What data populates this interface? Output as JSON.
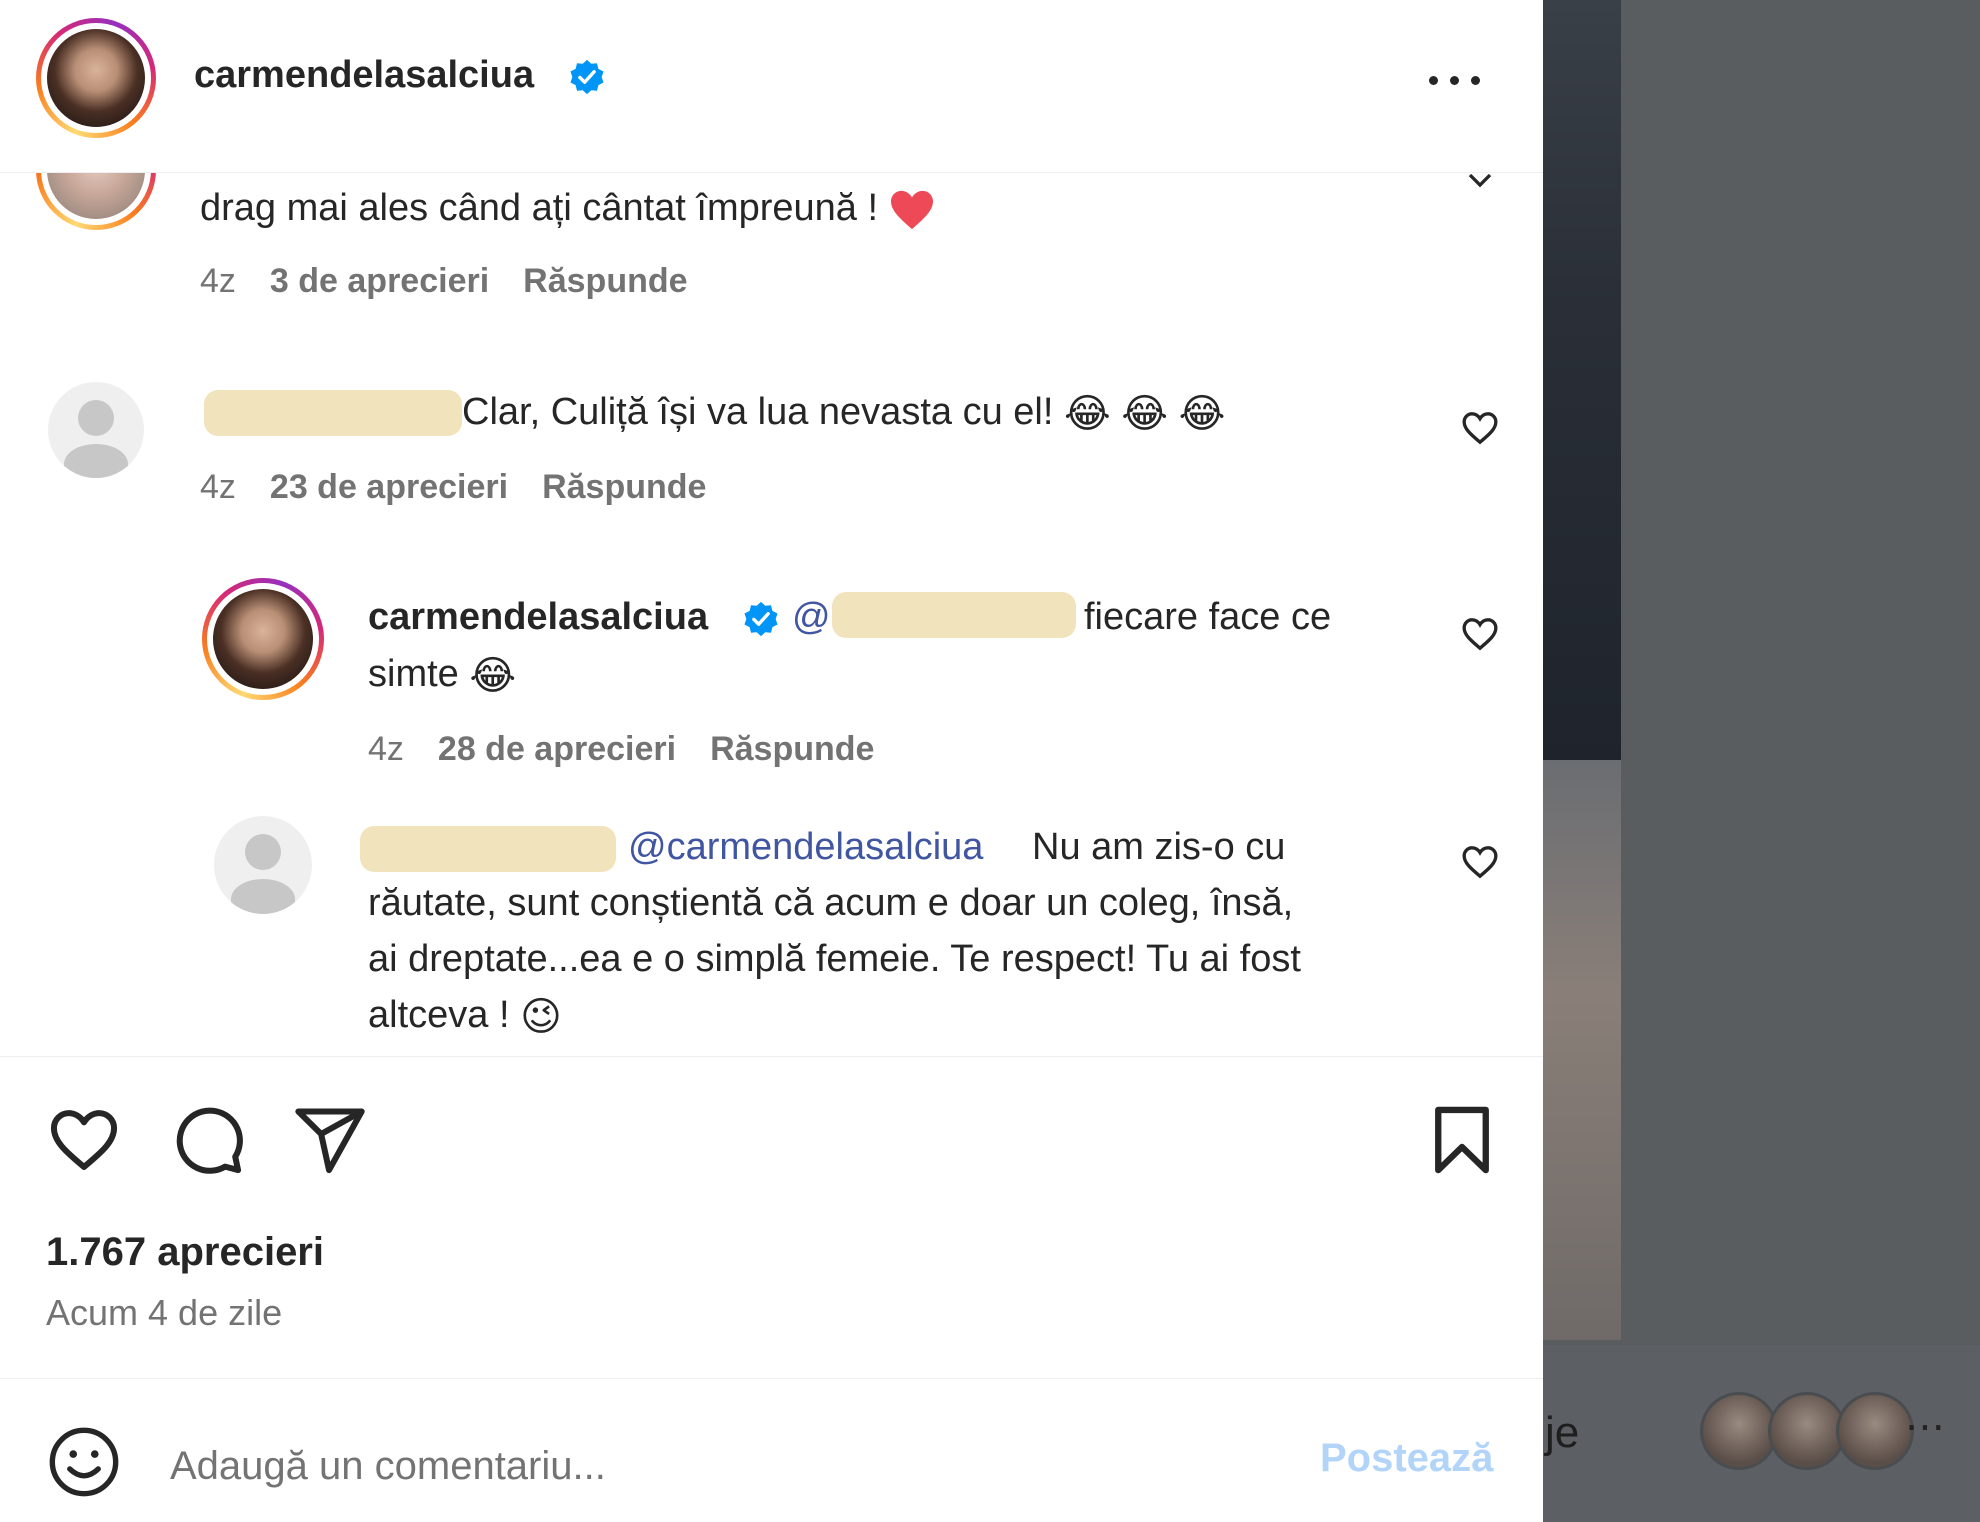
{
  "post": {
    "author": "carmendelasalciua",
    "more_icon": "more-horizontal-icon",
    "likes": "1.767 aprecieri",
    "time": "Acum 4 de zile"
  },
  "comments": [
    {
      "text": "drag mai ales când ați cântat împreună !",
      "time": "4z",
      "likes": "3 de aprecieri",
      "reply": "Răspunde"
    },
    {
      "text": "Clar, Culiță își va lua nevasta cu el!",
      "time": "4z",
      "likes": "23 de aprecieri",
      "reply": "Răspunde"
    },
    {
      "author": "carmendelasalciua",
      "mention": "@",
      "text_a": "fiecare face ce",
      "text_b": "simte",
      "time": "4z",
      "likes": "28 de aprecieri",
      "reply": "Răspunde"
    },
    {
      "mention": "@carmendelasalciua",
      "line1": "Nu am zis-o cu",
      "line2": "răutate, sunt conștientă că acum e doar un coleg, însă,",
      "line3": "ai dreptate...ea e o simplă femeie. Te respect! Tu ai fost",
      "line4": "altceva !"
    }
  ],
  "composer": {
    "placeholder": "Adaugă un comentariu...",
    "post_label": "Postează"
  },
  "background": {
    "partial_text": "je"
  },
  "colors": {
    "verified": "#0095f6",
    "mention": "#4056a1",
    "post_disabled": "#b3d4f9",
    "heart_red": "#ed4956"
  }
}
